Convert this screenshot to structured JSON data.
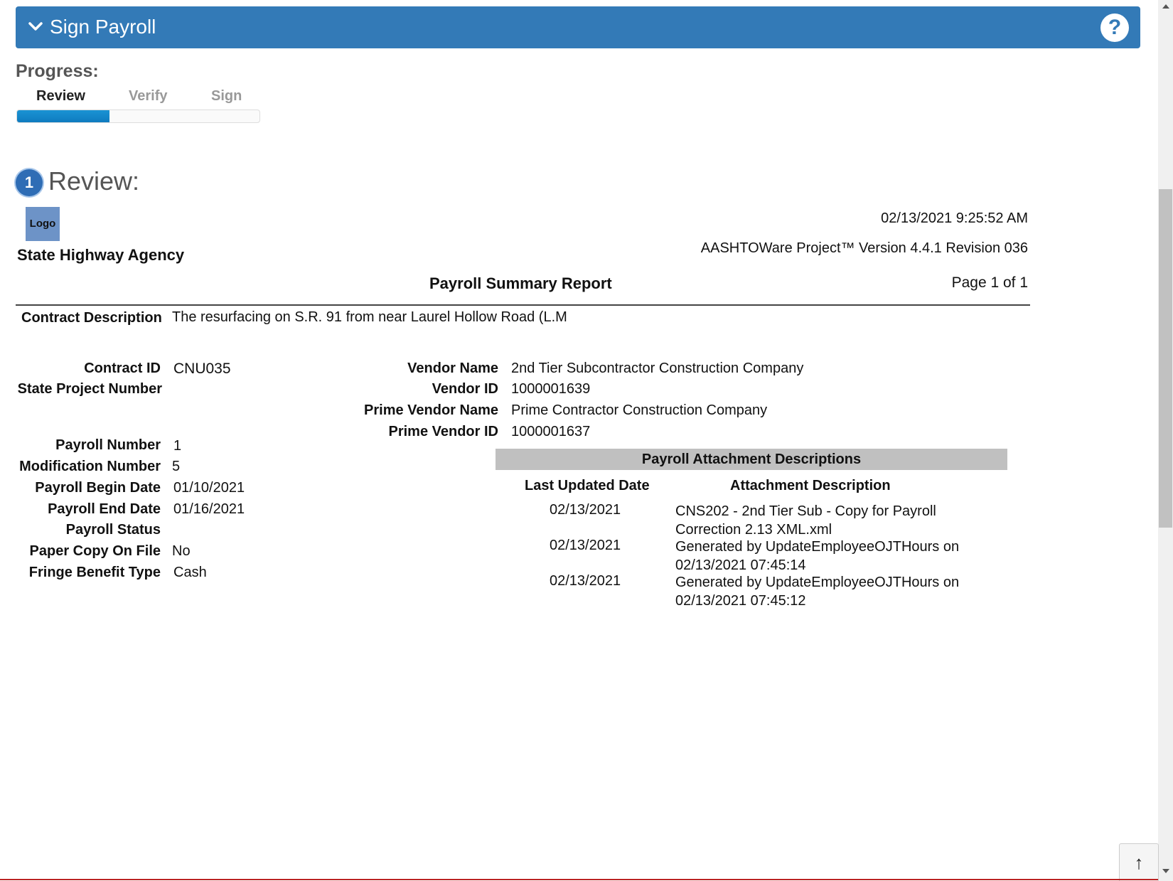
{
  "header": {
    "title": "Sign Payroll",
    "help_label": "?"
  },
  "progress": {
    "label": "Progress:",
    "steps": [
      "Review",
      "Verify",
      "Sign"
    ],
    "current_step": "Review",
    "completed_fraction": 0.38
  },
  "review": {
    "step_number": "1",
    "heading": "Review:"
  },
  "report": {
    "logo_text": "Logo",
    "agency": "State Highway Agency",
    "date": "02/13/2021 9:25:52 AM",
    "version": "AASHTOWare Project™ Version 4.4.1 Revision 036",
    "title": "Payroll Summary Report",
    "page": "Page 1 of 1",
    "contract_description_label": "Contract Description",
    "contract_description": "The resurfacing on S.R. 91 from near Laurel Hollow Road (L.M",
    "contract_id_label": "Contract ID",
    "contract_id": "CNU035",
    "state_project_number_label": "State Project Number",
    "state_project_number": "",
    "vendor_name_label": "Vendor Name",
    "vendor_name": "2nd Tier Subcontractor Construction Company",
    "vendor_id_label": "Vendor ID",
    "vendor_id": "1000001639",
    "prime_vendor_name_label": "Prime Vendor Name",
    "prime_vendor_name": "Prime Contractor Construction Company",
    "prime_vendor_id_label": "Prime Vendor ID",
    "prime_vendor_id": "1000001637",
    "payroll_number_label": "Payroll Number",
    "payroll_number": "1",
    "modification_number_label": "Modification Number",
    "modification_number": "5",
    "payroll_begin_date_label": "Payroll Begin Date",
    "payroll_begin_date": "01/10/2021",
    "payroll_end_date_label": "Payroll End Date",
    "payroll_end_date": "01/16/2021",
    "payroll_status_label": "Payroll Status",
    "payroll_status": "",
    "paper_copy_label": "Paper Copy On File",
    "paper_copy": "No",
    "fringe_benefit_label": "Fringe Benefit Type",
    "fringe_benefit": "Cash"
  },
  "attachments": {
    "title": "Payroll Attachment Descriptions",
    "col_date": "Last Updated Date",
    "col_desc": "Attachment Description",
    "rows": [
      {
        "date": "02/13/2021",
        "desc": "CNS202 - 2nd Tier Sub - Copy for Payroll Correction 2.13 XML.xml"
      },
      {
        "date": "02/13/2021",
        "desc": "Generated by UpdateEmployeeOJTHours on 02/13/2021 07:45:14"
      },
      {
        "date": "02/13/2021",
        "desc": "Generated by UpdateEmployeeOJTHours on 02/13/2021 07:45:12"
      }
    ]
  },
  "back_to_top": "↑",
  "colors": {
    "header_bg": "#337ab7",
    "progress_fill": "#1a93d4",
    "attachment_header_bg": "#c0c0c0",
    "badge_bg": "#2f6db5"
  }
}
